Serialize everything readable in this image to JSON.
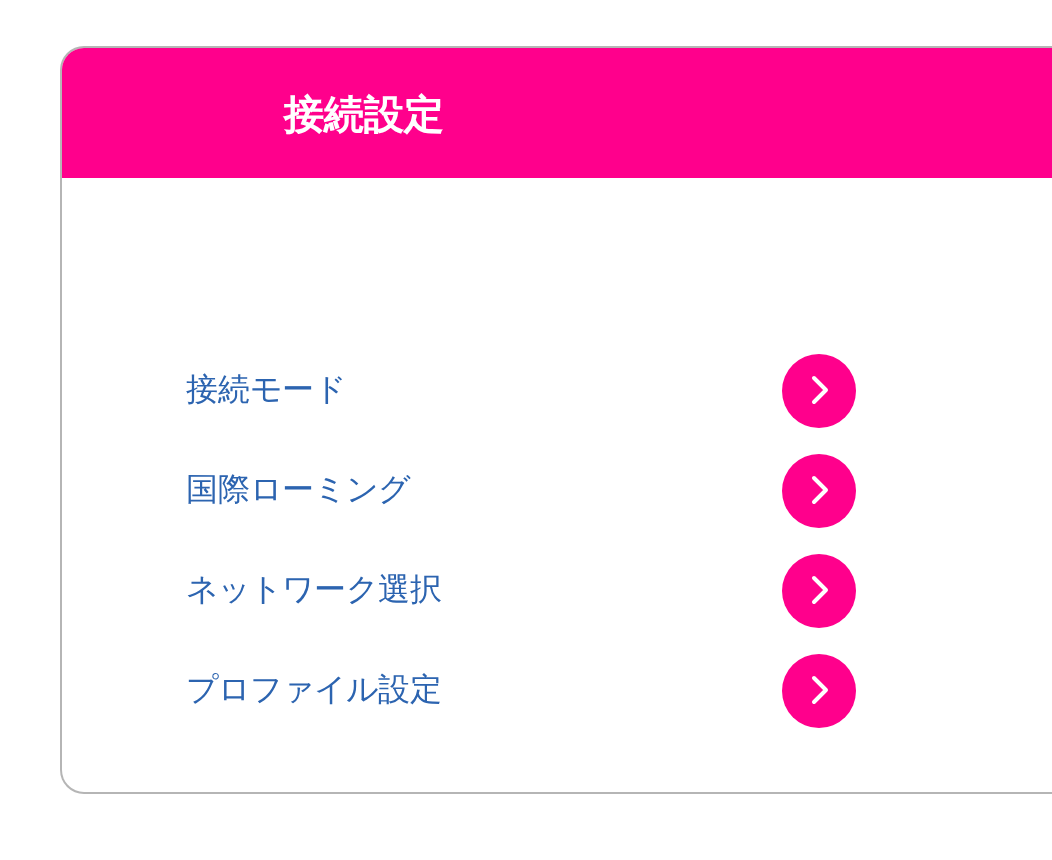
{
  "panel": {
    "title": "接続設定"
  },
  "menu_items": [
    {
      "label": "接続モード"
    },
    {
      "label": "国際ローミング"
    },
    {
      "label": "ネットワーク選択"
    },
    {
      "label": "プロファイル設定"
    }
  ]
}
